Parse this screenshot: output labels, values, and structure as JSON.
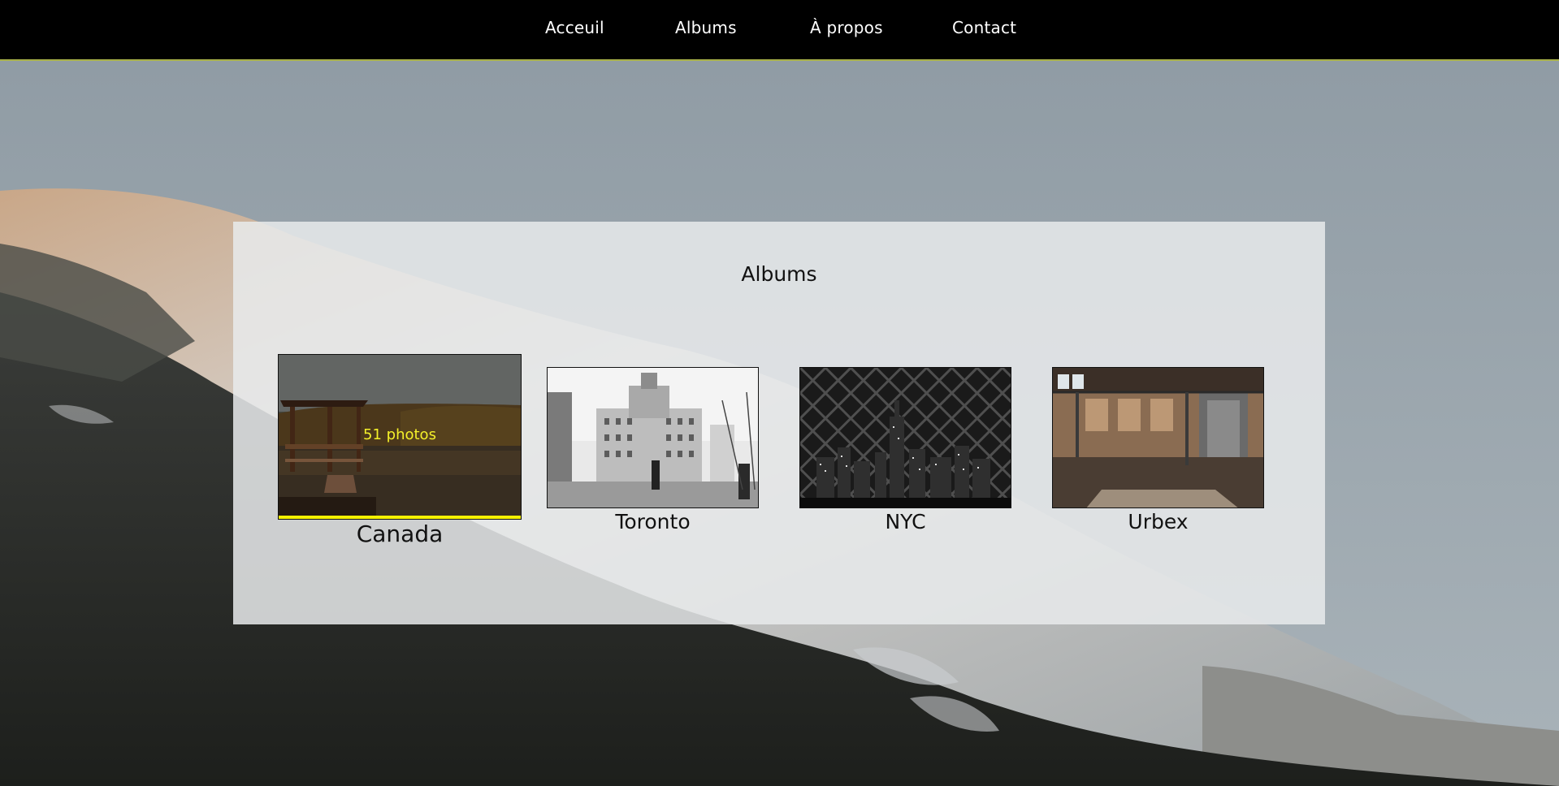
{
  "nav": {
    "items": [
      {
        "label": "Acceuil"
      },
      {
        "label": "Albums"
      },
      {
        "label": "À propos"
      },
      {
        "label": "Contact"
      }
    ]
  },
  "albums_section": {
    "title": "Albums",
    "albums": [
      {
        "name": "Canada",
        "count": "51 photos",
        "hovered": true
      },
      {
        "name": "Toronto"
      },
      {
        "name": "NYC"
      },
      {
        "name": "Urbex"
      }
    ]
  },
  "colors": {
    "nav_bg": "#000000",
    "nav_border": "#a9b24a",
    "hover_accent": "#f6f100"
  }
}
